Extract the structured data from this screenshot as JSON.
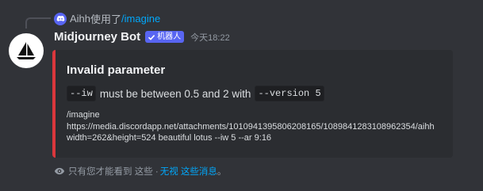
{
  "reply": {
    "user": "Aihh",
    "action": "使用了",
    "command": "/imagine"
  },
  "message": {
    "username": "Midjourney Bot",
    "badge": "机器人",
    "timestamp": "今天18:22"
  },
  "embed": {
    "accent_color": "#da373c",
    "title": "Invalid parameter",
    "desc_code_1": "--iw",
    "desc_text": "must be between 0.5 and 2 with",
    "desc_code_2": "--version 5",
    "cmd_line1": "/imagine",
    "cmd_line2": "https://media.discordapp.net/attachments/1010941395806208165/1089841283108962354/aihh",
    "cmd_line3": "width=262&height=524 beautiful lotus --iw 5 --ar 9:16"
  },
  "ephemeral": {
    "text": "只有您才能看到 这些 ·",
    "dismiss_link": "无视 这些消息",
    "trailing": "。"
  },
  "icons": {
    "reply": "discord-logo-icon",
    "badge": "checkmark-icon",
    "eye": "eye-icon",
    "avatar": "sailboat-icon"
  },
  "colors": {
    "background": "#313338",
    "embed_bg": "#2b2d31",
    "brand": "#5865f2",
    "link": "#00a8fc"
  }
}
